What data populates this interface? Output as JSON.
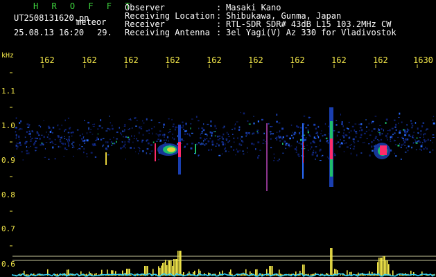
{
  "header": {
    "station_code": "H R O F F T",
    "filename": "UT2508131620.pn",
    "tag": "meteor",
    "datetime": "25.08.13 16:20",
    "count": "29.",
    "info": [
      {
        "label": "Observer",
        "value": "Masaki Kano"
      },
      {
        "label": "Receiving Location",
        "value": "Shibukawa, Gunma, Japan"
      },
      {
        "label": "Receiver",
        "value": "RTL-SDR SDR# 43dB L15 103.2MHz CW"
      },
      {
        "label": "Receiving Antenna",
        "value": "3el Yagi(V) Az 330 for Vladivostok"
      }
    ],
    "separator": ":"
  },
  "axis": {
    "unit": "kHz",
    "time_ticks": [
      "162",
      "162",
      "162",
      "162",
      "162",
      "162",
      "162",
      "162",
      "162",
      "1630"
    ],
    "freq_ticks": [
      "1.1",
      "1.0",
      "0.9",
      "0.8",
      "0.7",
      "0.6"
    ]
  },
  "colors": {
    "text": "#ffffff",
    "accent": "#f5e94a",
    "station": "#3fd93f",
    "signal_high": "#ff2a6a",
    "signal_mid": "#2a6cff",
    "baseline": "#2fd4ff",
    "bars": "#f5e94a"
  }
}
